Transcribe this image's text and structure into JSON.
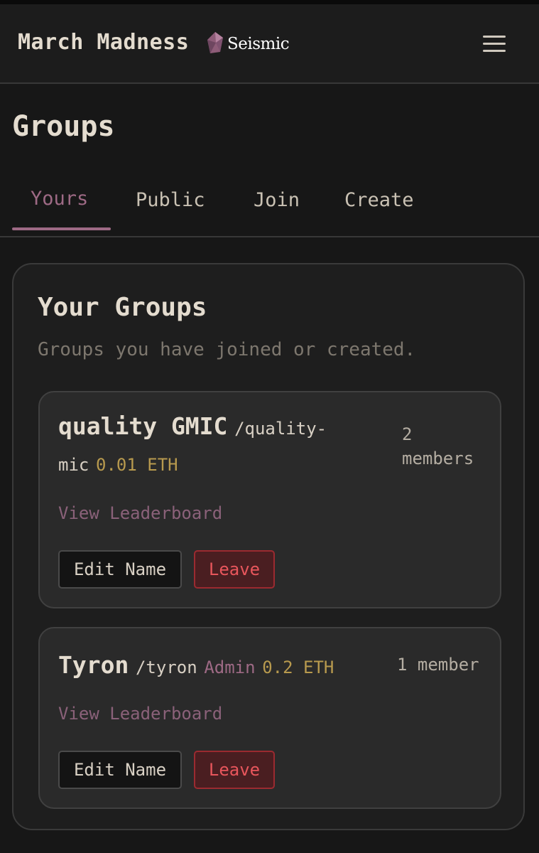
{
  "header": {
    "app_title": "March Madness",
    "brand_label": "Seismic",
    "brand_icon": "seismic-gem-icon",
    "menu_icon": "hamburger-menu-icon"
  },
  "page": {
    "title": "Groups"
  },
  "tabs": [
    {
      "label": "Yours",
      "active": true
    },
    {
      "label": "Public",
      "active": false
    },
    {
      "label": "Join",
      "active": false
    },
    {
      "label": "Create",
      "active": false
    }
  ],
  "panel": {
    "title": "Your Groups",
    "subtitle": "Groups you have joined or created."
  },
  "groups": [
    {
      "name": "quality GMIC",
      "slug_line1": "/quality-",
      "slug_line2": "mic",
      "price": "0.01 ETH",
      "members_line1": "2",
      "members_line2": "members",
      "leaderboard_label": "View Leaderboard",
      "edit_label": "Edit Name",
      "leave_label": "Leave"
    },
    {
      "name": "Tyron",
      "slug": "/tyron",
      "role": "Admin",
      "price": "0.2 ETH",
      "members": "1 member",
      "leaderboard_label": "View Leaderboard",
      "edit_label": "Edit Name",
      "leave_label": "Leave"
    }
  ],
  "colors": {
    "background": "#171717",
    "accent": "#9e6a85",
    "price": "#b89a4e",
    "danger": "#e8565c",
    "text": "#e4dccf"
  }
}
